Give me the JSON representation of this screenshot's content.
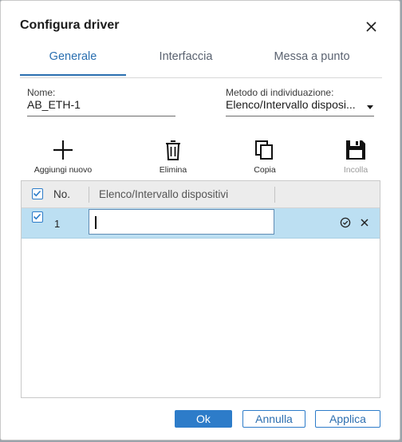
{
  "dialog": {
    "title": "Configura driver",
    "close_icon": "close-icon"
  },
  "tabs": [
    {
      "label": "Generale",
      "active": true
    },
    {
      "label": "Interfaccia",
      "active": false
    },
    {
      "label": "Messa a punto",
      "active": false
    }
  ],
  "form": {
    "name_label": "Nome:",
    "name_value": "AB_ETH-1",
    "method_label": "Metodo di individuazione:",
    "method_value": "Elenco/Intervallo disposi..."
  },
  "toolbar": {
    "add_label": "Aggiungi nuovo",
    "delete_label": "Elimina",
    "copy_label": "Copia",
    "paste_label": "Incolla"
  },
  "grid": {
    "columns": [
      "No.",
      "Elenco/Intervallo dispositivi"
    ],
    "rows": [
      {
        "number": "1",
        "value": "",
        "selected": true
      }
    ]
  },
  "buttons": {
    "ok": "Ok",
    "cancel": "Annulla",
    "apply": "Applica"
  },
  "colors": {
    "accent": "#2d7cc9",
    "selected_row": "#bcdff2"
  }
}
